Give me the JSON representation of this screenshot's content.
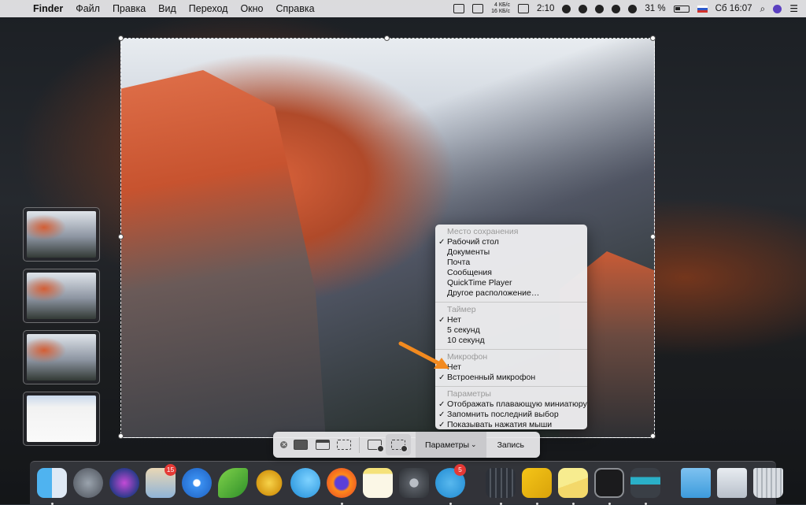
{
  "menubar": {
    "app": "Finder",
    "items": [
      "Файл",
      "Правка",
      "Вид",
      "Переход",
      "Окно",
      "Справка"
    ],
    "net_up": "4 КБ/с",
    "net_down": "16 КБ/с",
    "time_remaining": "2:10",
    "battery_percent": "31 %",
    "clock": "Сб 16:07"
  },
  "menu": {
    "save_header": "Место сохранения",
    "save_items": [
      {
        "label": "Рабочий стол",
        "checked": true
      },
      {
        "label": "Документы",
        "checked": false
      },
      {
        "label": "Почта",
        "checked": false
      },
      {
        "label": "Сообщения",
        "checked": false
      },
      {
        "label": "QuickTime Player",
        "checked": false
      },
      {
        "label": "Другое расположение…",
        "checked": false
      }
    ],
    "timer_header": "Таймер",
    "timer_items": [
      {
        "label": "Нет",
        "checked": true
      },
      {
        "label": "5 секунд",
        "checked": false
      },
      {
        "label": "10 секунд",
        "checked": false
      }
    ],
    "mic_header": "Микрофон",
    "mic_items": [
      {
        "label": "Нет",
        "checked": false
      },
      {
        "label": "Встроенный микрофон",
        "checked": true
      }
    ],
    "params_header": "Параметры",
    "params_items": [
      {
        "label": "Отображать плавающую миниатюру",
        "checked": true
      },
      {
        "label": "Запомнить последний выбор",
        "checked": true
      },
      {
        "label": "Показывать нажатия мыши",
        "checked": true
      }
    ]
  },
  "toolbar": {
    "options_label": "Параметры",
    "options_chevron": "⌄",
    "record_label": "Запись"
  },
  "dock": {
    "photos_badge": "15",
    "telegram_badge": "5"
  },
  "colors": {
    "accent_arrow": "#f28a1f",
    "badge": "#e53935"
  }
}
